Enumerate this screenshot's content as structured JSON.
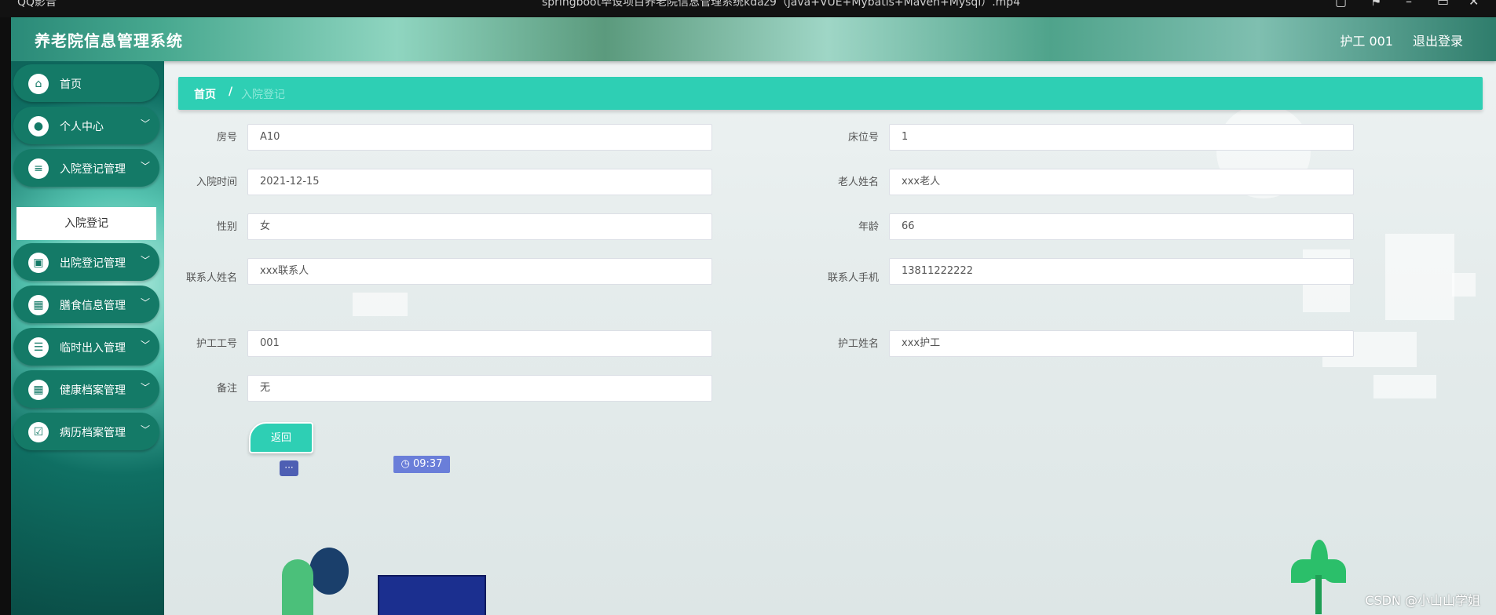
{
  "os": {
    "left_text": "QQ影音",
    "title_text": "springboot毕设项目养老院信息管理系统kdaz9（java+VUE+Mybatis+Maven+Mysql）.mp4"
  },
  "header": {
    "title": "养老院信息管理系统",
    "user": "护工 001",
    "logout": "退出登录"
  },
  "sidebar": {
    "items": [
      {
        "label": "首页",
        "icon": "home-icon",
        "glyph": "⌂"
      },
      {
        "label": "个人中心",
        "icon": "user-icon",
        "glyph": "●"
      },
      {
        "label": "入院登记管理",
        "icon": "sliders-icon",
        "glyph": "≡"
      },
      {
        "label": "出院登记管理",
        "icon": "chart-icon",
        "glyph": "▣"
      },
      {
        "label": "膳食信息管理",
        "icon": "grid-icon",
        "glyph": "▦"
      },
      {
        "label": "临时出入管理",
        "icon": "list-icon",
        "glyph": "☰"
      },
      {
        "label": "健康档案管理",
        "icon": "grid-icon",
        "glyph": "▦"
      },
      {
        "label": "病历档案管理",
        "icon": "checklist-icon",
        "glyph": "☑"
      }
    ],
    "submenu": "入院登记"
  },
  "breadcrumb": {
    "home": "首页",
    "sep": "/",
    "current": "入院登记"
  },
  "form": {
    "room_label": "房号",
    "room_value": "A10",
    "bed_label": "床位号",
    "bed_value": "1",
    "admit_time_label": "入院时间",
    "admit_time_value": "2021-12-15",
    "elder_name_label": "老人姓名",
    "elder_name_value": "xxx老人",
    "gender_label": "性别",
    "gender_value": "女",
    "age_label": "年龄",
    "age_value": "66",
    "contact_name_label": "联系人姓名",
    "contact_name_value": "xxx联系人",
    "contact_phone_label": "联系人手机",
    "contact_phone_value": "13811222222",
    "nurse_id_label": "护工工号",
    "nurse_id_value": "001",
    "nurse_name_label": "护工姓名",
    "nurse_name_value": "xxx护工",
    "remark_label": "备注",
    "remark_value": "无",
    "back_button": "返回"
  },
  "illustration": {
    "clock": "09:37",
    "chat": "···"
  },
  "watermark": "CSDN @小山山学姐"
}
